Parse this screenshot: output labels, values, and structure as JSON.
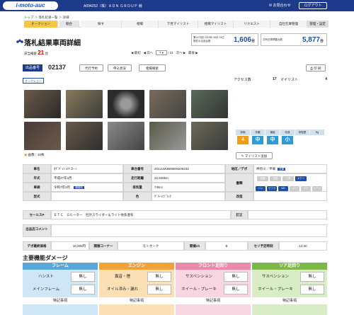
{
  "header": {
    "logo": "i-moto-auc",
    "company": "A094252（株）ＡＤＮ ＧＲＯＵＰ 様",
    "contact": "お問合わせ",
    "logout": "ログアウト"
  },
  "breadcrumb": "トップ ＞ 落札結果一覧 ＞ 詳細",
  "tabs": [
    "オークション",
    "競合",
    "探す",
    "相場",
    "下見マイリスト",
    "相場マイリスト",
    "リクエスト",
    "自社在庫管理",
    "管理・設定"
  ],
  "page_title": "落札結果車両詳細",
  "info_boxes": [
    {
      "label_top": "第1473回 2023年 06月 24日",
      "label_bottom": "現在の出品台数",
      "value": "1,606",
      "unit": "台"
    },
    {
      "label_top": "共有在庫掲載台数",
      "label_bottom": "",
      "value": "5,877",
      "unit": "台"
    }
  ],
  "hits": {
    "label": "該当検索",
    "count": "21",
    "unit": "台"
  },
  "pager": {
    "first": "最初",
    "prev": "前へ",
    "current": "7",
    "total": "/ 21",
    "next": "次へ",
    "last": "最後"
  },
  "lot": {
    "venue_label": "出品番号",
    "number": "02137",
    "btn_agent": "代行予約",
    "btn_apply": "申込状況",
    "btn_market": "相場検索",
    "btn_print": "印 刷",
    "auction_tag": "オークション"
  },
  "access": {
    "label": "アクセス数",
    "count": "17",
    "mylist_label": "マイリスト",
    "mylist_count": "4"
  },
  "photos_caption": "画像：10枚",
  "spec": {
    "name_label": "車名",
    "name_value": "ｵｸﾞｾﾞｯﾄ V7 ｽﾄｰﾝ",
    "year_label": "年式",
    "year_value": "平成27年3月",
    "inspection_label": "車検",
    "inspection_value": "令和7年3月",
    "inspection_badge": "車検残",
    "model_label": "型式",
    "model_value": "",
    "chassis_label": "車台番号",
    "chassis_value": "ZGULWUB00EM206232",
    "mileage_label": "走行距離",
    "mileage_value": "22,525km",
    "cc_label": "排気量",
    "cc_value": "746cc",
    "color_label": "色",
    "color_value": "ｸﾞﾘｰﾝ/ﾌﾞﾗｯｸ",
    "region_label": "地区／デポ",
    "region_value": "神奈川／平塚",
    "region_chip": "在庫",
    "docs_label": "書類",
    "doc_chips": [
      "書類",
      "自賠",
      "リ券",
      "ステー"
    ],
    "modify_label": "改造",
    "modify_chips": [
      "ハン",
      "マフラ",
      "S/D",
      "メー",
      "ステ",
      "シート"
    ]
  },
  "rating": {
    "headers": [
      "評価",
      "外観",
      "機能",
      "改造",
      "修復歴",
      "Rg"
    ],
    "values": [
      "4",
      "中",
      "中",
      "小",
      "",
      ""
    ],
    "mylist_btn": "マイリスト追加"
  },
  "sales": {
    "label": "セールスP",
    "value": "ＥＴＣ　Ｇヒーター　社外スライダー＆ライト他多連有",
    "correct_label": "訂正",
    "correct_value": ""
  },
  "comment": {
    "label": "出品店コメント",
    "value": ""
  },
  "deal": {
    "min_label": "デポ最終価格",
    "min_value": "16,000円",
    "corner_label": "開催コーナー",
    "corner_value": "モトオーク",
    "ch_label": "開催ch",
    "ch_value": "B",
    "time_label": "セリ予定時刻",
    "time_value": "12:40"
  },
  "damage": {
    "title": "主要機能ダメージ",
    "panels": [
      {
        "name": "フレーム",
        "color": "#5ba7d8",
        "bg": "#cfe6f6",
        "rows": [
          {
            "label": "ハンスト",
            "value": "無し"
          },
          {
            "label": "メインフレーム",
            "value": "無し"
          }
        ],
        "foot": "特記事項"
      },
      {
        "name": "エンジン",
        "color": "#f0a23a",
        "bg": "#fbe0b6",
        "rows": [
          {
            "label": "異音・煙",
            "value": "無し"
          },
          {
            "label": "オイル滲み・漏れ",
            "value": "無し"
          }
        ],
        "foot": "特記事項"
      },
      {
        "name": "フロント足回り",
        "color": "#e88aa8",
        "bg": "#f8d6e1",
        "rows": [
          {
            "label": "サスペンション",
            "value": "無し"
          },
          {
            "label": "ホイール・ブレーキ",
            "value": "無し"
          }
        ],
        "foot": "特記事項"
      },
      {
        "name": "リア足回り",
        "color": "#7bb84a",
        "bg": "#d8ecc5",
        "rows": [
          {
            "label": "サスペンション",
            "value": "無し"
          },
          {
            "label": "ホイール・ブレーキ",
            "value": "無し"
          }
        ],
        "foot": "特記事項"
      }
    ]
  },
  "colors": {
    "navy": "#1e3a8a",
    "accent_blue": "#1e4fa8",
    "hits_red": "#cc0000"
  }
}
